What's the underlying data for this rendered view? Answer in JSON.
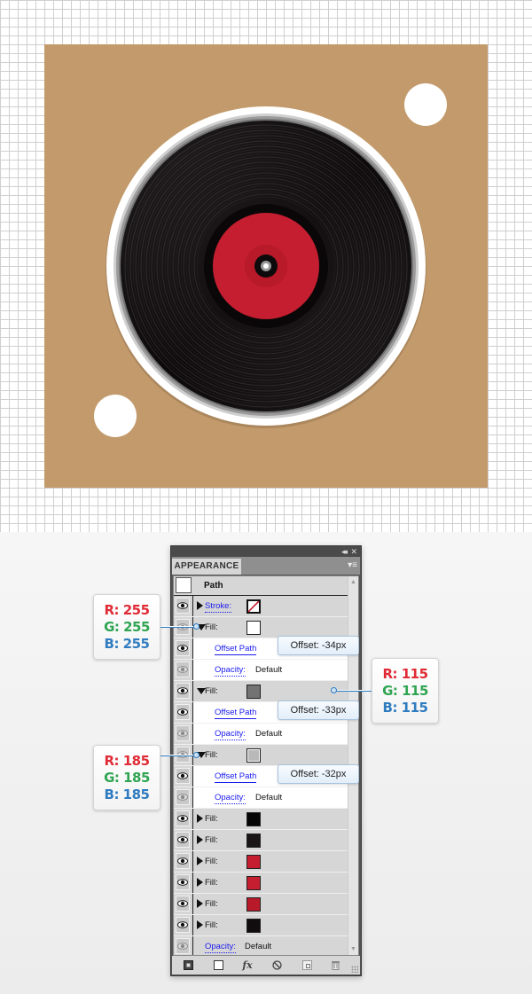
{
  "illustration": {
    "background_color": "#c39a6b",
    "dot_color": "#ffffff",
    "record": {
      "label_color": "#c41e30",
      "vinyl_color": "#151112",
      "rim_colors": [
        "#ffffff",
        "#b9b9b9",
        "#737373"
      ]
    }
  },
  "panel": {
    "title": "APPEARANCE",
    "collapse_icon": "◂◂",
    "close_icon": "✕",
    "menu_icon": "▾≡",
    "header": {
      "title": "Path"
    },
    "rows": [
      {
        "type": "attr",
        "label": "Stroke:",
        "link": true,
        "expand": "right",
        "swatch": "none-stroke",
        "eye": true
      },
      {
        "type": "attr",
        "label": "Fill:",
        "expand": "down",
        "swatch": "#ffffff",
        "eye": false
      },
      {
        "type": "effect",
        "label": "Offset Path",
        "eye": true
      },
      {
        "type": "opacity",
        "label": "Opacity:",
        "value": "Default",
        "eye": false
      },
      {
        "type": "attr",
        "label": "Fill:",
        "expand": "down",
        "swatch": "#737373",
        "eye": true
      },
      {
        "type": "effect",
        "label": "Offset Path",
        "eye": true
      },
      {
        "type": "opacity",
        "label": "Opacity:",
        "value": "Default",
        "eye": false
      },
      {
        "type": "attr",
        "label": "Fill:",
        "expand": "down",
        "swatch": "#b9b9b9",
        "eye": false,
        "double": true
      },
      {
        "type": "effect",
        "label": "Offset Path",
        "eye": true
      },
      {
        "type": "opacity",
        "label": "Opacity:",
        "value": "Default",
        "eye": false
      },
      {
        "type": "attr",
        "label": "Fill:",
        "expand": "right",
        "swatch": "#050505",
        "eye": true
      },
      {
        "type": "attr",
        "label": "Fill:",
        "expand": "right",
        "swatch": "#1a1617",
        "eye": true
      },
      {
        "type": "attr",
        "label": "Fill:",
        "expand": "right",
        "swatch": "#c41e30",
        "eye": true
      },
      {
        "type": "attr",
        "label": "Fill:",
        "expand": "right",
        "swatch": "#c41e30",
        "eye": true
      },
      {
        "type": "attr",
        "label": "Fill:",
        "expand": "right",
        "swatch": "#b81a2a",
        "eye": true
      },
      {
        "type": "attr",
        "label": "Fill:",
        "expand": "right",
        "swatch": "#110c0d",
        "eye": true
      },
      {
        "type": "opacity-top",
        "label": "Opacity:",
        "value": "Default",
        "eye": false
      }
    ],
    "footer_icons": [
      "add-stroke-icon",
      "add-fill-icon",
      "fx-icon",
      "clear-icon",
      "duplicate-icon",
      "trash-icon"
    ],
    "footer_fx": "fx"
  },
  "offset_callouts": [
    "Offset: -34px",
    "Offset: -33px",
    "Offset: -32px"
  ],
  "rgb_callouts": [
    {
      "r": "R: 255",
      "g": "G: 255",
      "b": "B: 255"
    },
    {
      "r": "R: 115",
      "g": "G: 115",
      "b": "B: 115"
    },
    {
      "r": "R: 185",
      "g": "G: 185",
      "b": "B: 185"
    }
  ]
}
